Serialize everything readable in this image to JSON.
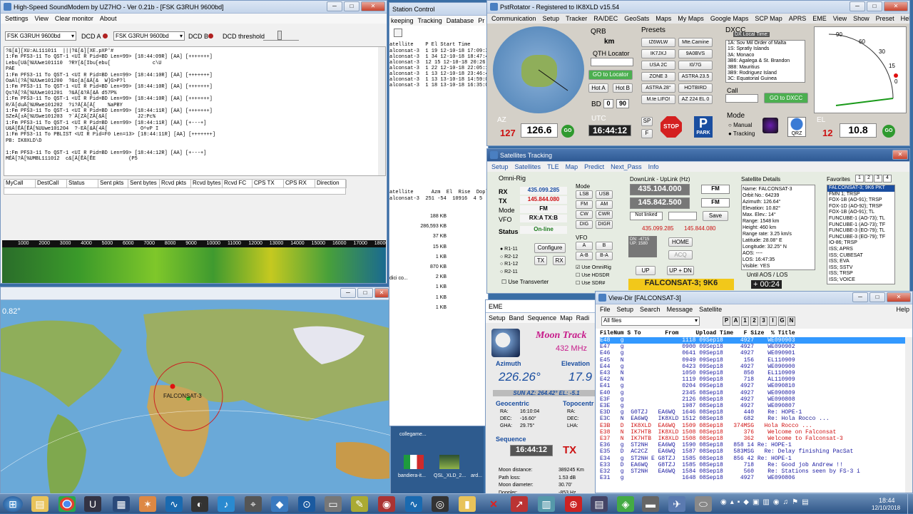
{
  "soundmodem": {
    "title": "High-Speed SoundModem by UZ7HO - Ver 0.21b - [FSK G3RUH 9600bd]",
    "menu": [
      "Settings",
      "View",
      "Clear monitor",
      "About"
    ],
    "modemA": "FSK G3RUH 9600bd",
    "dcdA": "DCD A",
    "modemB": "FSK G3RUH 9600bd",
    "dcdB": "DCD B",
    "dcdThreshold": "DCD threshold",
    "log": [
      "?&[&][XU:AL111011  |||?&[&][XE.pXP'#",
      "1:Fm PFS3-11 To QST-1 <UI R Pid=BD Len=99> [18:44:09R] [AA] [+++++++]",
      "Lebu[Uâ[%UUwe101110  ?RY[&[Ibu[ebu[              c\\U",
      "PAE",
      "1:Fm PFS3-11 To QST-1 <UI R Pid=BD Len=99> [18:44:10R] [AA] [+++++++]",
      "OaAl(?Ä[%UUwe101200  ?&o[ä[&Ä[&  W]G>P?l",
      "1:Fm PFS3-11 To QST-1 <UI R Pid=BD Len=99> [18:44:10R] [AA] [+++++++]",
      "Qs?Ä[?Ä[%UUwe101201  ?&Ä[&?Ä[&Ä d57P%",
      "1:Fm PFS3-11 To QST-1 <UI R Pid=BD Len=99> [18:44:10R] [AA] [+++++++]",
      "R/Ä[duÄ[%URwe101202  ?i?Ä[Ä[Ä[    %aPBY",
      "1:Fm PFS3-11 To QST-1 <UI R Pid=BD Len=99> [18:44:11R] [AA] [+++++++]",
      "SZeÄ[±Ä[%USwe101203  ?`Ä[ZÄ[ZÄ[&Ä[          J2:Pc%",
      "1:Fm PFS3-11 To QST-1 <UI R Pid=BD Len=99> [18:44:11R] [AA] [+---+]",
      "U&Ä[ÊÄ[ÊÄ[%UUwe101204  ?·EÄ[&Ä[4Ä[           O^vP I",
      "1:Fm PFS3-11 To PBLIST <UI R Pid=F0 Len=13> [18:44:11R] [AA] [+++++++]",
      "PB: IK8XLD\\D",
      "",
      "1:Fm PFS3-11 To QST-1 <UI R Pid=BD Len=99> [18:44:12R] [AA] [+---+]",
      "MÉÄ[?Ä[%UMBL111012  c&[Ä[ÊÄ[ÊE           (P5"
    ],
    "columns": [
      "MyCall",
      "DestCall",
      "Status",
      "Sent pkts",
      "Sent bytes",
      "Rcvd pkts",
      "Rcvd bytes",
      "Rcvd FC",
      "CPS TX",
      "CPS RX",
      "Direction"
    ],
    "freqs": [
      "1000",
      "2000",
      "3000",
      "4000",
      "5000",
      "6000",
      "7000",
      "8000",
      "9000",
      "10000",
      "11000",
      "12000",
      "13000",
      "14000",
      "15000",
      "16000",
      "17000",
      "18000"
    ]
  },
  "map": {
    "value": "0.82°",
    "sat": "FALCONSAT-3"
  },
  "pst": {
    "title": "PstRotator - Registered to IK8XLD   v15.54",
    "menu": [
      "Communication",
      "Setup",
      "Tracker",
      "RA/DEC",
      "GeoSats",
      "Maps",
      "My Maps",
      "Google Maps",
      "SCP Map",
      "APRS",
      "EME",
      "View",
      "Show",
      "Preset",
      "Help"
    ],
    "qrb": "QRB",
    "km": "km",
    "qthLocator": "QTH Locator",
    "goLocator": "GO to Locator",
    "hotA": "Hot A",
    "hotB": "Hot B",
    "bd": "BD",
    "bdVal1": "0",
    "bdVal2": "90",
    "utc": "UTC",
    "time": "16:44:12",
    "az": "AZ",
    "azSet": "127",
    "azVal": "126.6",
    "go": "GO",
    "el": "EL",
    "elSet": "12",
    "elVal": "10.8",
    "sp": "SP",
    "lp": "F",
    "stop": "STOP",
    "park": "PARK",
    "qrz": "QRZ",
    "presets": "Presets",
    "presetList": [
      "IZ6WLW",
      "Mte.Camine",
      "IK7JXJ",
      "9A0BVS",
      "USA 2C",
      "I0/7G",
      "ZONE 3",
      "ASTRA 23.5",
      "ASTRA 28°",
      "HOTBIRD",
      "M.te LIFO!",
      "AZ 224 EL 0"
    ],
    "dxcc": "DXCC",
    "dxLocal": "DX Local Time:",
    "dxList": [
      "1A: Sov Mil Order of Malta",
      "1S: Spratly Islands",
      "3A: Monaco",
      "3B6: Agalega & St. Brandon",
      "3B8: Mauritius",
      "3B9: Rodriguez Island",
      "3C: Equatorial Guinea"
    ],
    "call": "Call",
    "goDxcc": "GO to DXCC",
    "mode": "Mode",
    "manual": "Manual",
    "tracking": "Tracking",
    "dialLabels": [
      "90",
      "60",
      "30",
      "15",
      "0",
      "120",
      "150",
      "180"
    ]
  },
  "sat": {
    "title": "Satellites Tracking",
    "menu": [
      "Setup",
      "Satellites",
      "TLE",
      "Map",
      "Predict",
      "Next_Pass",
      "Info"
    ],
    "omni": "Omni-Rig",
    "rx": "RX",
    "rxVal": "435.099.285",
    "tx": "TX",
    "txVal": "145.844.080",
    "modeL": "Mode",
    "modeV": "FM",
    "vfo": "VFO",
    "vfoV": "RX:A TX:B",
    "status": "Status",
    "statusV": "On-line",
    "configure": "Configure",
    "rigs": [
      "R1-11",
      "R2-12",
      "R1-12",
      "R2-11"
    ],
    "transverter": "Use Transverter",
    "modes": [
      "LSB",
      "USB",
      "FM",
      "AM",
      "CW",
      "CWR",
      "DIG",
      "DIGR"
    ],
    "vfoBtns": [
      "A",
      "B",
      "A-B",
      "B-A"
    ],
    "txb": "TX",
    "rxb": "RX",
    "useOmni": "Use OmniRig",
    "useHds": "Use HDSDR",
    "useSdr": "Use SDR#",
    "downUp": "DownLink - UpLink (Hz)",
    "down": "435.104.000",
    "up": "145.842.500",
    "fm": "FM",
    "notLinked": "Not linked",
    "save": "Save",
    "dlShow": "435.099.285",
    "ulShow": "145.844.080",
    "dnLbl": "DN: -4715",
    "upLbl": "UP: 1580",
    "home": "HOME",
    "acq": "ACQ",
    "upb": "UP",
    "updn": "UP + DN",
    "satName": "FALCONSAT-3; 9K6",
    "detailsT": "Satellite Details",
    "details": [
      "Name: FALCONSAT-3",
      "Orbit No.: 64239",
      "Azimuth: 126.64°",
      "Elevation: 10.82°",
      "Max. Elev.: 14°",
      "Range: 1548 km",
      "Height: 460 km",
      "Range rate: 3.25 km/s",
      "Latitude: 28.08° E",
      "Longitude: 32.25° N",
      "AOS: ----",
      "LOS: 16:47:35",
      "Visible: YES"
    ],
    "aosLbl": "Until AOS / LOS",
    "aos": "+ 00:24",
    "favT": "Favorites",
    "favTabs": [
      "1",
      "2",
      "3",
      "4"
    ],
    "fav": [
      "FALCONSAT-3; 9K6 PKT",
      "FMN 1; TRSP",
      "FOX-1B (AO-91); TRSP",
      "FOX-1D (AO-92); TRSP",
      "FOX-1B (AO-91); TL",
      "FUNCUBE-1 (AO-73); TL",
      "FUNCUBE-1 (AO-73); TF",
      "FUNCUBE-3 (EO-79); TL",
      "FUNCUBE-3 (EO-79); TF",
      "IO-86; TRSP",
      "ISS; APRS",
      "ISS; CUBESAT",
      "ISS; EVA",
      "ISS; SSTV",
      "ISS; TRSP",
      "ISS; VOICE"
    ]
  },
  "rc": {
    "title": "Station Control",
    "menu": [
      "keeping",
      "Tracking",
      "Database",
      "Pr"
    ],
    "hdr": "atellite    P El Start Time",
    "rows": [
      "alconsat-3  1 19 12-10-18 17:09:32",
      "alconsat-3  1 34 12-10-18 18:47:44",
      "alconsat-3  12 15 12-10-18 20:26:10",
      "alconsat-3  1 22 12-10-18 22:05:12",
      "alconsat-3  1 13 12-10-18 23:46:46",
      "alconsat-3  1 13 13-10-18 14:59:01",
      "alconsat-3  1 18 13-10-18 16:35:09"
    ],
    "hdr2": "atellite      Azm  El  Rise  Doplr  Ma",
    "row2": "alconsat-3  251 -54  10916  4 5",
    "sizes": [
      "188 KB",
      "286,593 KB",
      "37 KB",
      "15 KB",
      "1 KB",
      "870 KB",
      "2 KB",
      "1 KB",
      "1 KB",
      "1 KB"
    ],
    "dici": "dici co...",
    "folder": "collegame...",
    "icons": [
      "bandiera-it...",
      "QSL_XLD_2...",
      "ard..."
    ]
  },
  "eme": {
    "title": "EME",
    "menu": [
      "Setup",
      "Band",
      "Sequence",
      "Map",
      "Radi"
    ],
    "moon": "Moon Track",
    "freq": "432 MHz",
    "azL": "Azimuth",
    "az": "226.26°",
    "elL": "Elevation",
    "el": "17.9",
    "sun": "SUN  AZ: 264.42°  EL: -5.1",
    "geo": "Geocentric",
    "topo": "Topocentr",
    "geoVals": [
      [
        "RA:",
        "16:10:04"
      ],
      [
        "DEC:",
        "-16.60°"
      ],
      [
        "GHA:",
        "29.75°"
      ]
    ],
    "topoVals": [
      "RA:",
      "DEC:",
      "LHA:"
    ],
    "seq": "Sequence",
    "seqTime": "16:44:12",
    "tx": "TX",
    "info": [
      [
        "Moon distance:",
        "389245 Km"
      ],
      [
        "Path loss:",
        "1.53 dB"
      ],
      [
        "Moon diameter:",
        "30.70'"
      ],
      [
        "Doppler:",
        "-853 Hz"
      ]
    ]
  },
  "vd": {
    "title": "View-Dir [FALCONSAT-3]",
    "menu": [
      "File",
      "Setup",
      "Search",
      "Message",
      "Satellite"
    ],
    "help": "Help",
    "filter": "All files",
    "tbtn": [
      "P",
      "A",
      "1",
      "2",
      "3",
      "I",
      "G",
      "N"
    ],
    "cols": "FileNum S To       From     Upload Time   F Size  % Title",
    "rows": [
      [
        "E48   g                 1118 09Sep18     4927    WE090903",
        "sel"
      ],
      [
        "E47   g                 0900 09Sep18     4927    WE090902",
        ""
      ],
      [
        "E46   g                 0641 09Sep18     4927    WE090901",
        ""
      ],
      [
        "E45   N                 0949 09Sep18      156    EL110909",
        ""
      ],
      [
        "E44   g                 0423 09Sep18     4927    WE090900",
        ""
      ],
      [
        "E43   N                 1050 09Sep18      850    EL110909",
        ""
      ],
      [
        "E42   N                 1119 09Sep18      718    AL110909",
        ""
      ],
      [
        "E41   g                 0204 09Sep18     4927    WE090810",
        ""
      ],
      [
        "E40   g                 2345 08Sep18     4927    WE090809",
        ""
      ],
      [
        "E3F   g                 2126 08Sep18     4927    WE090808",
        ""
      ],
      [
        "E3E   g                 1987 08Sep18     4927    WE090807",
        ""
      ],
      [
        "E3D   g  G0TZJ   EA6WQ  1646 08Sep18      440    Re: HOPE-1",
        ""
      ],
      [
        "E3C   N  EA6WQ   IK8XLD 1512 08Sep18      682    Re: Hola Rocco ...",
        "blue"
      ],
      [
        "E3B   D  IK8XLD  EA6WQ  1509 08Sep18   374MSG   Hola Rocco ...",
        "red"
      ],
      [
        "E38   N  IK7HTB  IK8XLD 1508 08Sep18      376    Welcome on Falconsat",
        "red"
      ],
      [
        "E37   N  IK7HTB  IK8XLD 1508 08Sep18      362    Welcome to Falconsat-3",
        "red"
      ],
      [
        "E36   g  ST2NH   EA6WQ  1590 08Sep18   858 14 Re: HOPE-1",
        ""
      ],
      [
        "E35   D  AC2CZ   EA6WQ  1587 08Sep18   583MSG   Re: Delay finishing PacSat",
        ""
      ],
      [
        "E34   g  ST2NH E G8TZJ  1585 08Sep18   856 42 Re: HOPE-1",
        ""
      ],
      [
        "E33   D  EA6WQ   G8TZJ  1585 08Sep18      718    Re: Good job Andrew !!",
        ""
      ],
      [
        "E32   g  ST2NH   EA6WQ  1584 08Sep18      560    Re: Stations seen by FS-3 i",
        ""
      ],
      [
        "E31   g                 1648 08Sep18     4927    WE090806",
        ""
      ]
    ]
  },
  "clock": {
    "time": "18:44",
    "date": "12/10/2018"
  },
  "colors": {
    "accent": "#1565c0",
    "lcdRed": "#cc1111",
    "highlight": "#3399ff"
  }
}
